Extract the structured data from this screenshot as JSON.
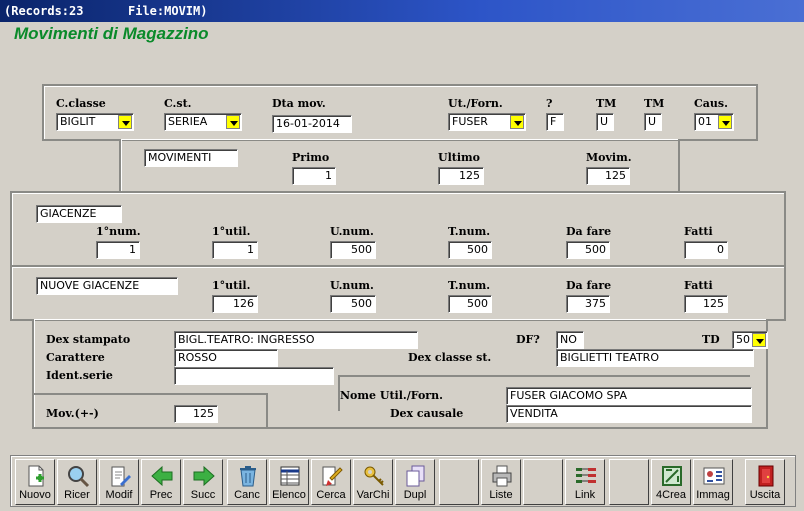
{
  "titlebar": {
    "records": "(Records:23",
    "file": "File:MOVIM)"
  },
  "app_title": "Movimenti di Magazzino",
  "top": {
    "labels": {
      "cclasse": "C.classe",
      "cst": "C.st.",
      "dta": "Dta mov.",
      "utforn": "Ut./Forn.",
      "q": "?",
      "tm1": "TM",
      "tm2": "TM",
      "caus": "Caus."
    },
    "values": {
      "cclasse": "BIGLIT",
      "cst": "SERIEA",
      "dta": "16-01-2014",
      "utforn": "FUSER",
      "q": "F",
      "tm1": "U",
      "tm2": "U",
      "caus": "01"
    }
  },
  "mov": {
    "name": "MOVIMENTI",
    "labels": {
      "primo": "Primo",
      "ultimo": "Ultimo",
      "movim": "Movim."
    },
    "values": {
      "primo": "1",
      "ultimo": "125",
      "movim": "125"
    }
  },
  "giac": {
    "name": "GIACENZE",
    "labels": {
      "num": "1°num.",
      "util": "1°util.",
      "unum": "U.num.",
      "tnum": "T.num.",
      "dafare": "Da fare",
      "fatti": "Fatti"
    },
    "values": {
      "num": "1",
      "util": "1",
      "unum": "500",
      "tnum": "500",
      "dafare": "500",
      "fatti": "0"
    }
  },
  "nuove": {
    "name": "NUOVE GIACENZE",
    "labels": {
      "util": "1°util.",
      "unum": "U.num.",
      "tnum": "T.num.",
      "dafare": "Da fare",
      "fatti": "Fatti"
    },
    "values": {
      "util": "126",
      "unum": "500",
      "tnum": "500",
      "dafare": "375",
      "fatti": "125"
    }
  },
  "bottom": {
    "labels": {
      "dex": "Dex stampato",
      "df": "DF?",
      "td": "TD",
      "car": "Carattere",
      "dexcl": "Dex classe st.",
      "ident": "Ident.serie",
      "nomeut": "Nome Util./Forn.",
      "dexcaus": "Dex causale",
      "movpm": "Mov.(+-)"
    },
    "values": {
      "dex": "BIGL.TEATRO: INGRESSO",
      "df": "NO",
      "td": "50",
      "car": "ROSSO",
      "dexcl": "BIGLIETTI TEATRO",
      "ident": "",
      "nomeut": "FUSER GIACOMO SPA",
      "dexcaus": "VENDITA",
      "movpm": "125"
    }
  },
  "toolbar": [
    {
      "label": "Nuovo",
      "icon": "new-document-icon"
    },
    {
      "label": "Ricer",
      "icon": "magnifier-icon"
    },
    {
      "label": "Modif",
      "icon": "edit-document-icon"
    },
    {
      "label": "Prec",
      "icon": "arrow-left-icon"
    },
    {
      "label": "Succ",
      "icon": "arrow-right-icon"
    },
    {
      "label": "Canc",
      "icon": "trash-icon"
    },
    {
      "label": "Elenco",
      "icon": "list-table-icon"
    },
    {
      "label": "Cerca",
      "icon": "search-brush-icon"
    },
    {
      "label": "VarChi",
      "icon": "keys-icon"
    },
    {
      "label": "Dupl",
      "icon": "duplicate-icon"
    },
    {
      "label": "",
      "icon": ""
    },
    {
      "label": "Liste",
      "icon": "printer-icon"
    },
    {
      "label": "",
      "icon": ""
    },
    {
      "label": "Link",
      "icon": "link-grid-icon"
    },
    {
      "label": "",
      "icon": ""
    },
    {
      "label": "4Crea",
      "icon": "create-icon"
    },
    {
      "label": "Immag",
      "icon": "image-card-icon"
    },
    {
      "label": "Uscita",
      "icon": "exit-door-icon"
    }
  ],
  "colors": {
    "title_green": "#0a8a2a",
    "dropdown_yellow": "#ffff00",
    "titlebar_blue": "#0a246a"
  }
}
